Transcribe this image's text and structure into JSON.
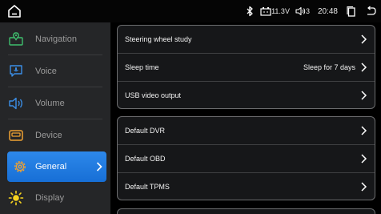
{
  "status_bar": {
    "battery_text": "11.3V",
    "volume_text": "3",
    "clock": "20:48",
    "icons": [
      "home-icon",
      "bluetooth-icon",
      "battery-icon",
      "volume-icon",
      "recent-apps-icon",
      "back-icon"
    ]
  },
  "sidebar": {
    "items": [
      {
        "label": "Navigation",
        "icon": "map-icon"
      },
      {
        "label": "Voice",
        "icon": "chat-icon"
      },
      {
        "label": "Volume",
        "icon": "speaker-icon"
      },
      {
        "label": "Device",
        "icon": "device-icon"
      },
      {
        "label": "General",
        "icon": "gear-icon",
        "active": true
      },
      {
        "label": "Display",
        "icon": "brightness-icon"
      }
    ]
  },
  "settings": {
    "group1": [
      {
        "label": "Steering wheel study",
        "value": ""
      },
      {
        "label": "Sleep time",
        "value": "Sleep for 7 days"
      },
      {
        "label": "USB video output",
        "value": ""
      }
    ],
    "group2": [
      {
        "label": "Default DVR",
        "value": ""
      },
      {
        "label": "Default OBD",
        "value": ""
      },
      {
        "label": "Default TPMS",
        "value": ""
      }
    ]
  },
  "colors": {
    "accent": "#2680e6",
    "sidebar_bg": "#252628",
    "card_border": "#6b6c6e",
    "icon_green": "#3fbf6e",
    "icon_blue": "#3b8fe8",
    "icon_orange": "#f0a232",
    "icon_yellow": "#f5d21f"
  }
}
